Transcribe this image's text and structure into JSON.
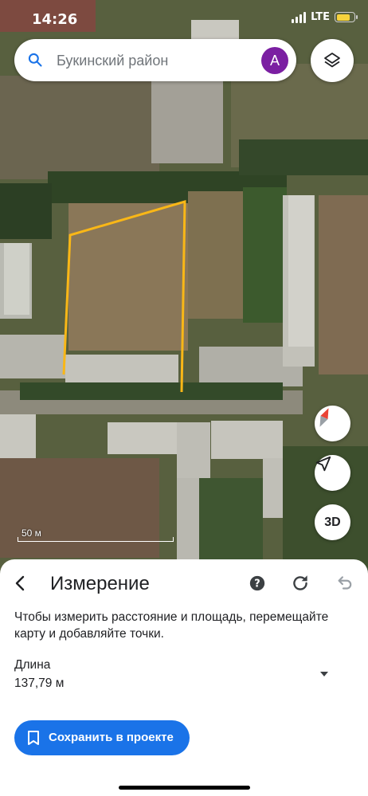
{
  "status_bar": {
    "time": "14:26",
    "network": "LTE",
    "battery_level": 0.78
  },
  "search": {
    "text": "Букинский район",
    "avatar_letter": "A"
  },
  "map": {
    "scale_label": "50 м",
    "compass_icon": "compass-icon",
    "location_icon": "navigation-arrow-icon",
    "three_d_label": "3D",
    "layers_icon": "layers-icon",
    "measure_line_color": "#f9b717"
  },
  "sheet": {
    "title": "Измерение",
    "instruction": "Чтобы измерить расстояние и площадь, перемещайте карту и добавляйте точки.",
    "length_label": "Длина",
    "length_value": "137,79 м",
    "save_label": "Сохранить в проекте",
    "accent_color": "#1a73e8"
  }
}
